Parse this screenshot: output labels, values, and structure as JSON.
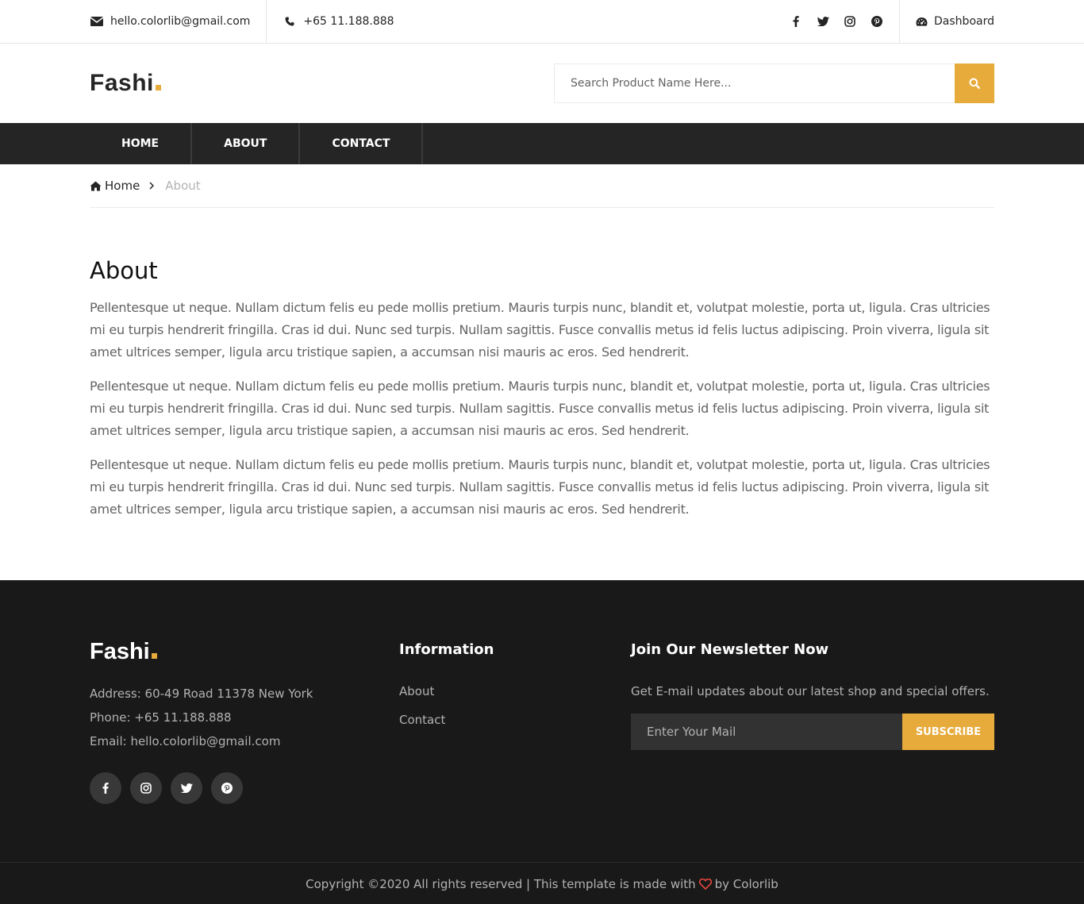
{
  "topbar": {
    "email": "hello.colorlib@gmail.com",
    "phone": "+65 11.188.888",
    "social_icons": [
      "facebook-icon",
      "twitter-icon",
      "instagram-icon",
      "pinterest-icon"
    ],
    "dashboard_label": "Dashboard"
  },
  "header": {
    "logo": "Fashi",
    "search_placeholder": "Search Product Name Here..."
  },
  "nav": {
    "items": [
      "Home",
      "About",
      "Contact"
    ]
  },
  "breadcrumb": {
    "home": "Home",
    "current": "About"
  },
  "main": {
    "title": "About",
    "paragraphs": [
      "Pellentesque ut neque. Nullam dictum felis eu pede mollis pretium. Mauris turpis nunc, blandit et, volutpat molestie, porta ut, ligula. Cras ultricies mi eu turpis hendrerit fringilla. Cras id dui. Nunc sed turpis. Nullam sagittis. Fusce convallis metus id felis luctus adipiscing. Proin viverra, ligula sit amet ultrices semper, ligula arcu tristique sapien, a accumsan nisi mauris ac eros. Sed hendrerit.",
      "Pellentesque ut neque. Nullam dictum felis eu pede mollis pretium. Mauris turpis nunc, blandit et, volutpat molestie, porta ut, ligula. Cras ultricies mi eu turpis hendrerit fringilla. Cras id dui. Nunc sed turpis. Nullam sagittis. Fusce convallis metus id felis luctus adipiscing. Proin viverra, ligula sit amet ultrices semper, ligula arcu tristique sapien, a accumsan nisi mauris ac eros. Sed hendrerit.",
      "Pellentesque ut neque. Nullam dictum felis eu pede mollis pretium. Mauris turpis nunc, blandit et, volutpat molestie, porta ut, ligula. Cras ultricies mi eu turpis hendrerit fringilla. Cras id dui. Nunc sed turpis. Nullam sagittis. Fusce convallis metus id felis luctus adipiscing. Proin viverra, ligula sit amet ultrices semper, ligula arcu tristique sapien, a accumsan nisi mauris ac eros. Sed hendrerit."
    ]
  },
  "footer": {
    "logo": "Fashi",
    "address": "Address: 60-49 Road 11378 New York",
    "phone": "Phone: +65 11.188.888",
    "email": "Email: hello.colorlib@gmail.com",
    "social_icons": [
      "facebook-icon",
      "instagram-icon",
      "twitter-icon",
      "pinterest-icon"
    ],
    "info_title": "Information",
    "info_links": [
      "About",
      "Contact"
    ],
    "newsletter_title": "Join Our Newsletter Now",
    "newsletter_text": "Get E-mail updates about our latest shop and special offers.",
    "newsletter_placeholder": "Enter Your Mail",
    "subscribe_label": "Subscribe",
    "copyright_before": "Copyright ©2020 All rights reserved | This template is made with",
    "copyright_after": "by Colorlib"
  },
  "colors": {
    "accent": "#e7ab3c",
    "dark": "#252525",
    "footer_bg": "#191919",
    "heart": "#e7473c"
  }
}
